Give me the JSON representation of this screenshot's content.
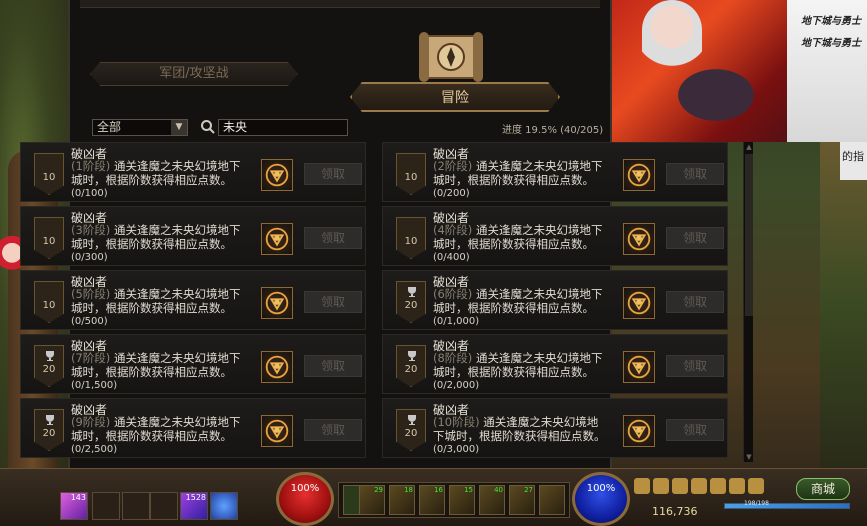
{
  "tabs": {
    "guild_war": "军团/攻坚战",
    "adventure": "冒险"
  },
  "filter": {
    "category_selected": "全部",
    "search_value": "未央"
  },
  "progress_text": "进度 19.5% (40/205)",
  "claim_label": "领取",
  "achievements": [
    {
      "title": "破凶者",
      "stage": "(1阶段)",
      "desc": " 通关逢魔之未央幻境地下城时，根据阶数获得相应点数。",
      "count": "(0/100)",
      "points": "10",
      "trophy": false
    },
    {
      "title": "破凶者",
      "stage": "(2阶段)",
      "desc": " 通关逢魔之未央幻境地下城时，根据阶数获得相应点数。",
      "count": "(0/200)",
      "points": "10",
      "trophy": false
    },
    {
      "title": "破凶者",
      "stage": "(3阶段)",
      "desc": " 通关逢魔之未央幻境地下城时，根据阶数获得相应点数。",
      "count": "(0/300)",
      "points": "10",
      "trophy": false
    },
    {
      "title": "破凶者",
      "stage": "(4阶段)",
      "desc": " 通关逢魔之未央幻境地下城时，根据阶数获得相应点数。",
      "count": "(0/400)",
      "points": "10",
      "trophy": false
    },
    {
      "title": "破凶者",
      "stage": "(5阶段)",
      "desc": " 通关逢魔之未央幻境地下城时，根据阶数获得相应点数。",
      "count": "(0/500)",
      "points": "10",
      "trophy": false
    },
    {
      "title": "破凶者",
      "stage": "(6阶段)",
      "desc": " 通关逢魔之未央幻境地下城时，根据阶数获得相应点数。",
      "count": "(0/1,000)",
      "points": "20",
      "trophy": true
    },
    {
      "title": "破凶者",
      "stage": "(7阶段)",
      "desc": " 通关逢魔之未央幻境地下城时，根据阶数获得相应点数。",
      "count": "(0/1,500)",
      "points": "20",
      "trophy": true
    },
    {
      "title": "破凶者",
      "stage": "(8阶段)",
      "desc": " 通关逢魔之未央幻境地下城时，根据阶数获得相应点数。",
      "count": "(0/2,000)",
      "points": "20",
      "trophy": true
    },
    {
      "title": "破凶者",
      "stage": "(9阶段)",
      "desc": " 通关逢魔之未央幻境地下城时，根据阶数获得相应点数。",
      "count": "(0/2,500)",
      "points": "20",
      "trophy": true
    },
    {
      "title": "破凶者",
      "stage": "(10阶段)",
      "desc": " 通关逢魔之未央幻境地下城时，根据阶数获得相应点数。",
      "count": "(0/3,000)",
      "points": "20",
      "trophy": true
    }
  ],
  "hud": {
    "hp_pct": "100%",
    "mp_pct": "100%",
    "gold": "116,736",
    "shop_label": "商城",
    "item1_count": "143",
    "item2_count": "1528",
    "exp_fraction": 1.0,
    "exp_text": "198/198"
  },
  "colors": {
    "accent_gold": "#9a7a4a",
    "claim_disabled": "#5e5a54"
  }
}
